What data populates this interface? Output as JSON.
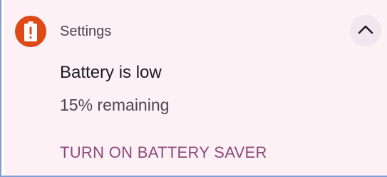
{
  "notification": {
    "app_name": "Settings",
    "app_icon": "battery-alert-icon",
    "title": "Battery is low",
    "body": "15% remaining",
    "action_label": "TURN ON BATTERY SAVER",
    "expand_icon": "chevron-up-icon"
  },
  "colors": {
    "app_icon_background": "#dd4a17",
    "card_background": "#fdf1f6",
    "action_text": "#8c4a7c",
    "frame_border": "#7f9fd6"
  }
}
